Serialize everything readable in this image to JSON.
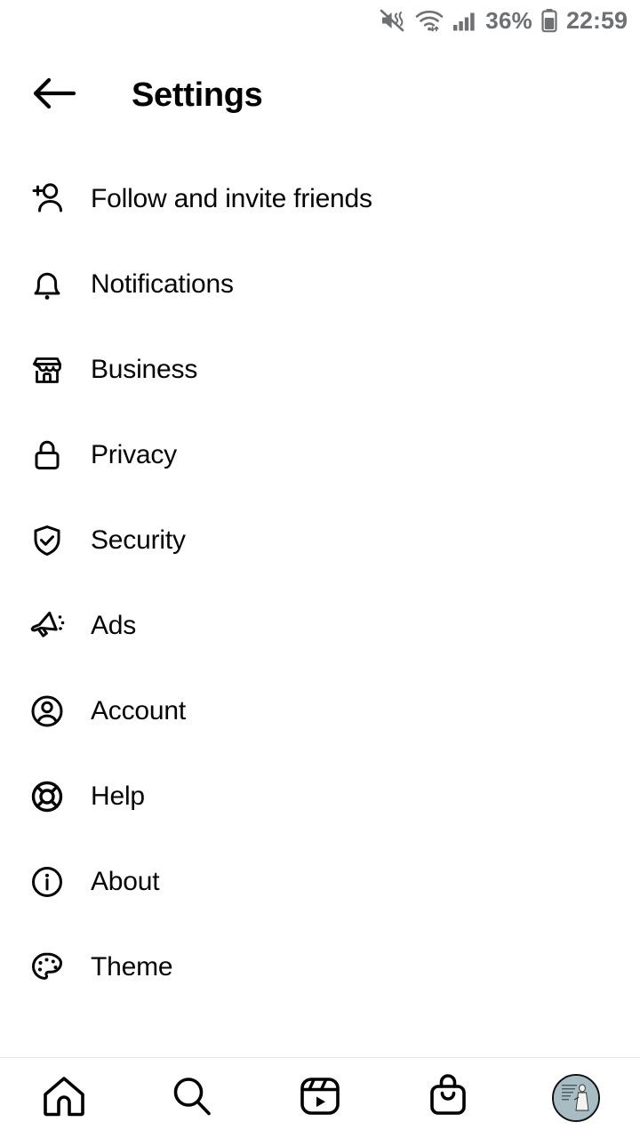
{
  "status_bar": {
    "sound_icon": "mute-icon",
    "wifi_icon": "wifi-icon",
    "signal_icon": "cellular-signal-icon",
    "battery_percent": "36%",
    "battery_icon": "battery-icon",
    "time": "22:59"
  },
  "header": {
    "back_icon": "back-arrow-icon",
    "title": "Settings"
  },
  "settings": {
    "items": [
      {
        "label": "Follow and invite friends",
        "icon": "person-add-icon"
      },
      {
        "label": "Notifications",
        "icon": "bell-icon"
      },
      {
        "label": "Business",
        "icon": "storefront-icon"
      },
      {
        "label": "Privacy",
        "icon": "lock-icon"
      },
      {
        "label": "Security",
        "icon": "shield-check-icon"
      },
      {
        "label": "Ads",
        "icon": "megaphone-icon"
      },
      {
        "label": "Account",
        "icon": "account-circle-icon"
      },
      {
        "label": "Help",
        "icon": "lifebuoy-icon"
      },
      {
        "label": "About",
        "icon": "info-circle-icon"
      },
      {
        "label": "Theme",
        "icon": "palette-icon"
      }
    ]
  },
  "bottom_nav": {
    "items": [
      {
        "name": "home",
        "icon": "home-icon"
      },
      {
        "name": "search",
        "icon": "search-icon"
      },
      {
        "name": "reels",
        "icon": "reels-icon"
      },
      {
        "name": "shop",
        "icon": "shopping-bag-icon"
      },
      {
        "name": "profile",
        "icon": "profile-avatar"
      }
    ]
  },
  "colors": {
    "text": "#050505",
    "status_text": "#6e7073",
    "separator": "#e4e4e4",
    "avatar_bg": "#a8bcc4"
  }
}
